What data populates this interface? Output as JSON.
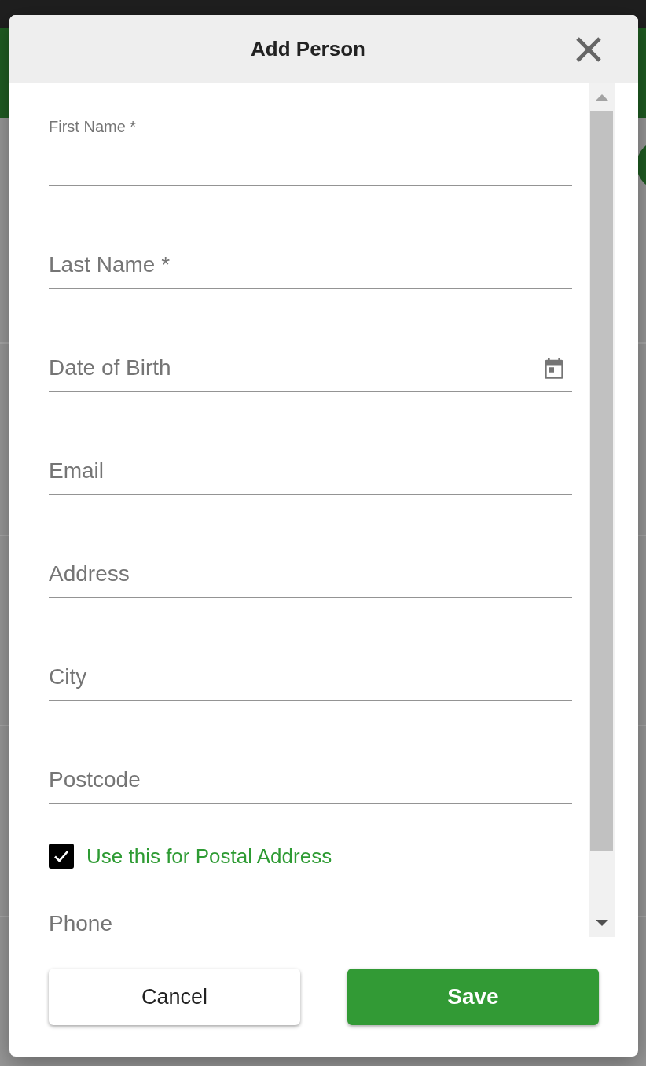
{
  "dialog": {
    "title": "Add Person"
  },
  "form": {
    "items": [
      {
        "kind": "text",
        "label": "First Name *",
        "floated": true
      },
      {
        "kind": "text",
        "label": "Last Name *",
        "floated": false
      },
      {
        "kind": "date",
        "label": "Date of Birth",
        "floated": false
      },
      {
        "kind": "text",
        "label": "Email",
        "floated": false
      },
      {
        "kind": "text",
        "label": "Address",
        "floated": false
      },
      {
        "kind": "text",
        "label": "City",
        "floated": false
      },
      {
        "kind": "text",
        "label": "Postcode",
        "floated": false
      },
      {
        "kind": "checkbox",
        "label": "Use this for Postal Address",
        "checked": true
      },
      {
        "kind": "text",
        "label": "Phone",
        "floated": false
      }
    ]
  },
  "buttons": [
    {
      "label": "Cancel",
      "kind": "secondary"
    },
    {
      "label": "Save",
      "kind": "primary"
    }
  ]
}
